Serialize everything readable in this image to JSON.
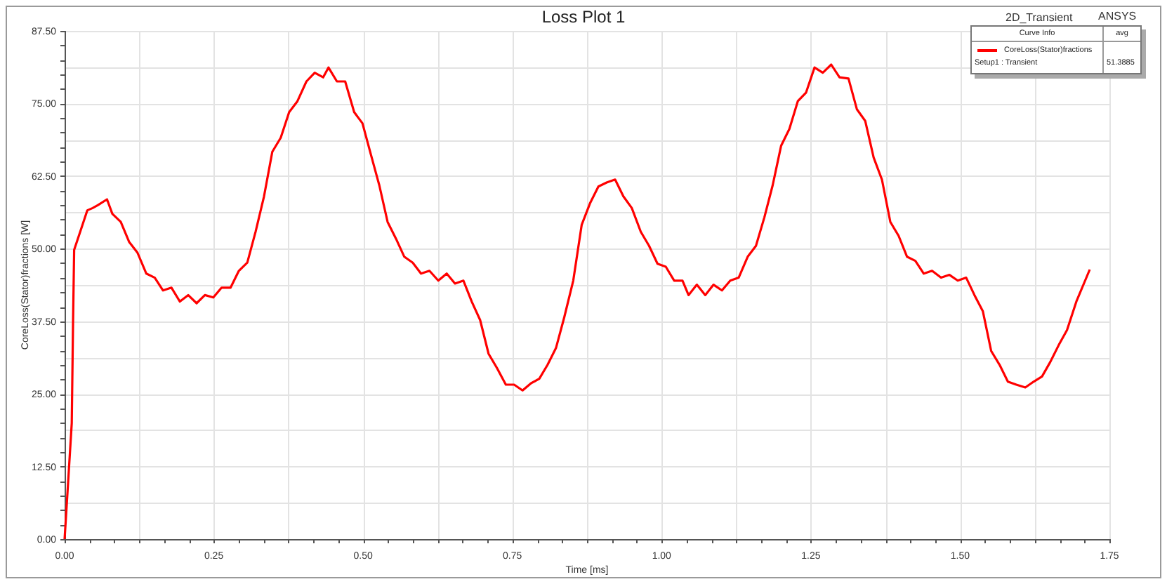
{
  "plot": {
    "title": "Loss Plot 1",
    "design": "2D_Transient",
    "brand": "ANSYS",
    "legend": {
      "columns": [
        "Curve Info",
        "avg"
      ],
      "setup": "Setup1 : Transient",
      "avg": "51.3885"
    },
    "chart_data": {
      "type": "line",
      "grid": true,
      "xlabel": "Time [ms]",
      "ylabel": "CoreLoss(Stator)fractions [W]",
      "xlim": [
        0,
        1.75
      ],
      "ylim": [
        0,
        87.5
      ],
      "xticks": [
        {
          "value": 0,
          "label": "0.00"
        },
        {
          "value": 0.25,
          "label": "0.25"
        },
        {
          "value": 0.5,
          "label": "0.50"
        },
        {
          "value": 0.75,
          "label": "0.75"
        },
        {
          "value": 1,
          "label": "1.00"
        },
        {
          "value": 1.25,
          "label": "1.25"
        },
        {
          "value": 1.5,
          "label": "1.50"
        },
        {
          "value": 1.75,
          "label": "1.75"
        }
      ],
      "yticks": [
        {
          "value": 0,
          "label": "0.00"
        },
        {
          "value": 12.5,
          "label": "12.50"
        },
        {
          "value": 25,
          "label": "25.00"
        },
        {
          "value": 37.5,
          "label": "37.50"
        },
        {
          "value": 50,
          "label": "50.00"
        },
        {
          "value": 62.5,
          "label": "62.50"
        },
        {
          "value": 75,
          "label": "75.00"
        },
        {
          "value": 87.5,
          "label": "87.50"
        }
      ],
      "x": [
        0,
        0.005,
        0.012,
        0.014,
        0.016,
        0.026,
        0.038,
        0.047,
        0.056,
        0.071,
        0.08,
        0.094,
        0.108,
        0.122,
        0.137,
        0.151,
        0.165,
        0.179,
        0.193,
        0.207,
        0.221,
        0.235,
        0.249,
        0.263,
        0.278,
        0.292,
        0.306,
        0.32,
        0.334,
        0.348,
        0.362,
        0.376,
        0.39,
        0.405,
        0.419,
        0.433,
        0.442,
        0.456,
        0.47,
        0.485,
        0.499,
        0.513,
        0.527,
        0.541,
        0.555,
        0.569,
        0.583,
        0.597,
        0.611,
        0.626,
        0.64,
        0.654,
        0.668,
        0.682,
        0.696,
        0.71,
        0.724,
        0.739,
        0.753,
        0.767,
        0.781,
        0.795,
        0.809,
        0.823,
        0.837,
        0.852,
        0.866,
        0.88,
        0.894,
        0.908,
        0.922,
        0.936,
        0.95,
        0.965,
        0.979,
        0.993,
        1.007,
        1.021,
        1.035,
        1.045,
        1.059,
        1.073,
        1.087,
        1.101,
        1.115,
        1.129,
        1.144,
        1.158,
        1.172,
        1.186,
        1.2,
        1.214,
        1.228,
        1.242,
        1.256,
        1.27,
        1.284,
        1.298,
        1.313,
        1.327,
        1.341,
        1.355,
        1.369,
        1.383,
        1.397,
        1.411,
        1.425,
        1.439,
        1.453,
        1.468,
        1.482,
        1.496,
        1.51,
        1.524,
        1.538,
        1.552,
        1.566,
        1.58,
        1.594,
        1.609,
        1.623,
        1.637,
        1.651,
        1.665,
        1.679,
        1.695,
        1.717
      ],
      "series": [
        {
          "name": "CoreLoss(Stator)fractions",
          "color": "#ff0000",
          "values": [
            0,
            8.2,
            20,
            37,
            49.8,
            52.9,
            56.6,
            57,
            57.5,
            58.5,
            56,
            54.6,
            51.2,
            49.3,
            45.7,
            45,
            42.8,
            43.3,
            40.9,
            42,
            40.6,
            42,
            41.6,
            43.3,
            43.3,
            46.2,
            47.6,
            52.9,
            59,
            66.7,
            69.1,
            73.5,
            75.4,
            78.8,
            80.3,
            79.5,
            81.2,
            78.8,
            78.8,
            73.5,
            71.6,
            66.2,
            60.9,
            54.6,
            51.7,
            48.6,
            47.6,
            45.7,
            46.2,
            44.5,
            45.7,
            44,
            44.5,
            40.9,
            37.7,
            31.9,
            29.5,
            26.6,
            26.6,
            25.6,
            26.8,
            27.6,
            30,
            32.9,
            38.2,
            44.5,
            54.1,
            57.8,
            60.7,
            61.4,
            61.9,
            59,
            57,
            52.9,
            50.5,
            47.4,
            46.9,
            44.5,
            44.5,
            42,
            43.8,
            42,
            43.8,
            42.8,
            44.5,
            45,
            48.6,
            50.5,
            55.4,
            60.9,
            67.7,
            70.6,
            75.4,
            76.9,
            81.2,
            80.3,
            81.7,
            79.5,
            79.3,
            74,
            72,
            65.7,
            61.9,
            54.6,
            52.2,
            48.6,
            47.9,
            45.7,
            46.2,
            45,
            45.5,
            44.5,
            45,
            42,
            39.2,
            32.4,
            30,
            27.1,
            26.6,
            26.1,
            27.1,
            28,
            30.5,
            33.4,
            36,
            41,
            46.4
          ]
        }
      ]
    }
  }
}
